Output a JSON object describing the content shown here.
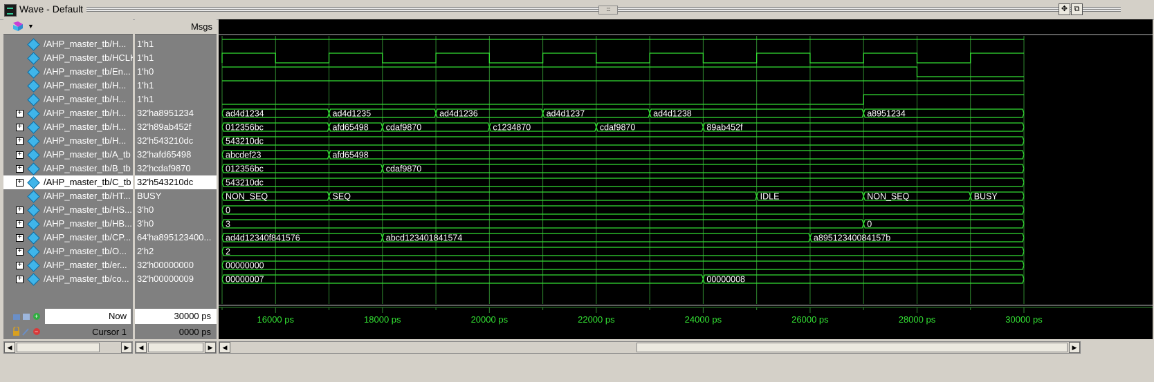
{
  "window": {
    "title": "Wave - Default"
  },
  "names_header": {
    "filter_icon": "wave-filter-icon"
  },
  "values_header": {
    "label": "Msgs"
  },
  "signals": [
    {
      "name": "/AHP_master_tb/H...",
      "value": "1'h1",
      "expandable": false
    },
    {
      "name": "/AHP_master_tb/HCLK",
      "value": "1'h1",
      "expandable": false
    },
    {
      "name": "/AHP_master_tb/En...",
      "value": "1'h0",
      "expandable": false
    },
    {
      "name": "/AHP_master_tb/H...",
      "value": "1'h1",
      "expandable": false
    },
    {
      "name": "/AHP_master_tb/H...",
      "value": "1'h1",
      "expandable": false
    },
    {
      "name": "/AHP_master_tb/H...",
      "value": "32'ha8951234",
      "expandable": true
    },
    {
      "name": "/AHP_master_tb/H...",
      "value": "32'h89ab452f",
      "expandable": true
    },
    {
      "name": "/AHP_master_tb/H...",
      "value": "32'h543210dc",
      "expandable": true
    },
    {
      "name": "/AHP_master_tb/A_tb",
      "value": "32'hafd65498",
      "expandable": true
    },
    {
      "name": "/AHP_master_tb/B_tb",
      "value": "32'hcdaf9870",
      "expandable": true
    },
    {
      "name": "/AHP_master_tb/C_tb",
      "value": "32'h543210dc",
      "expandable": true,
      "selected": true
    },
    {
      "name": "/AHP_master_tb/HT...",
      "value": "BUSY",
      "expandable": false
    },
    {
      "name": "/AHP_master_tb/HS...",
      "value": "3'h0",
      "expandable": true
    },
    {
      "name": "/AHP_master_tb/HB...",
      "value": "3'h0",
      "expandable": true
    },
    {
      "name": "/AHP_master_tb/CP...",
      "value": "64'ha895123400...",
      "expandable": true
    },
    {
      "name": "/AHP_master_tb/O...",
      "value": "2'h2",
      "expandable": true
    },
    {
      "name": "/AHP_master_tb/er...",
      "value": "32'h00000000",
      "expandable": true
    },
    {
      "name": "/AHP_master_tb/co...",
      "value": "32'h00000009",
      "expandable": true
    }
  ],
  "waveform": {
    "time_start_ps": 15000,
    "time_end_ps": 30000,
    "ticks": [
      "16000 ps",
      "18000 ps",
      "20000 ps",
      "22000 ps",
      "24000 ps",
      "26000 ps",
      "28000 ps",
      "30000 ps"
    ],
    "tick_values": [
      16000,
      18000,
      20000,
      22000,
      24000,
      26000,
      28000,
      30000
    ],
    "colors": {
      "wave": "#33e033",
      "grid": "#2f8a2f",
      "background": "#000000",
      "tick_label": "#33e033"
    },
    "bit_signals": [
      {
        "row": 0,
        "transitions": [
          [
            15000,
            1
          ]
        ]
      },
      {
        "row": 1,
        "transitions": [
          [
            15000,
            0
          ],
          [
            15000,
            1
          ],
          [
            16000,
            0
          ],
          [
            17000,
            1
          ],
          [
            18000,
            0
          ],
          [
            19000,
            1
          ],
          [
            20000,
            0
          ],
          [
            21000,
            1
          ],
          [
            22000,
            0
          ],
          [
            23000,
            1
          ],
          [
            24000,
            0
          ],
          [
            25000,
            1
          ],
          [
            26000,
            0
          ],
          [
            27000,
            1
          ],
          [
            28000,
            0
          ],
          [
            29000,
            1
          ]
        ]
      },
      {
        "row": 2,
        "transitions": [
          [
            15000,
            1
          ],
          [
            28000,
            0
          ]
        ]
      },
      {
        "row": 3,
        "transitions": [
          [
            15000,
            1
          ]
        ]
      },
      {
        "row": 4,
        "transitions": [
          [
            15000,
            0
          ],
          [
            27000,
            1
          ]
        ]
      }
    ],
    "bus_signals": [
      {
        "row": 5,
        "segments": [
          [
            15000,
            "ad4d1234"
          ],
          [
            17000,
            "ad4d1235"
          ],
          [
            19000,
            "ad4d1236"
          ],
          [
            21000,
            "ad4d1237"
          ],
          [
            23000,
            "ad4d1238"
          ],
          [
            27000,
            "a8951234"
          ]
        ]
      },
      {
        "row": 6,
        "segments": [
          [
            15000,
            "012356bc"
          ],
          [
            17000,
            "afd65498"
          ],
          [
            18000,
            "cdaf9870"
          ],
          [
            20000,
            "c1234870"
          ],
          [
            22000,
            "cdaf9870"
          ],
          [
            24000,
            "89ab452f"
          ]
        ]
      },
      {
        "row": 7,
        "segments": [
          [
            15000,
            "543210dc"
          ]
        ]
      },
      {
        "row": 8,
        "segments": [
          [
            15000,
            "abcdef23"
          ],
          [
            17000,
            "afd65498"
          ]
        ]
      },
      {
        "row": 9,
        "segments": [
          [
            15000,
            "012356bc"
          ],
          [
            18000,
            "cdaf9870"
          ]
        ]
      },
      {
        "row": 10,
        "segments": [
          [
            15000,
            "543210dc"
          ]
        ]
      },
      {
        "row": 11,
        "segments": [
          [
            15000,
            "NON_SEQ"
          ],
          [
            17000,
            "SEQ"
          ],
          [
            25000,
            "IDLE"
          ],
          [
            27000,
            "NON_SEQ"
          ],
          [
            29000,
            "BUSY"
          ]
        ]
      },
      {
        "row": 12,
        "segments": [
          [
            15000,
            "0"
          ]
        ]
      },
      {
        "row": 13,
        "segments": [
          [
            15000,
            "3"
          ],
          [
            27000,
            "0"
          ]
        ]
      },
      {
        "row": 14,
        "segments": [
          [
            15000,
            "ad4d12340f841576"
          ],
          [
            18000,
            "abcd123401841574"
          ],
          [
            26000,
            "a89512340084157b"
          ]
        ]
      },
      {
        "row": 15,
        "segments": [
          [
            15000,
            "2"
          ]
        ]
      },
      {
        "row": 16,
        "segments": [
          [
            15000,
            "00000000"
          ]
        ]
      },
      {
        "row": 17,
        "segments": [
          [
            15000,
            "00000007"
          ],
          [
            24000,
            "00000008"
          ]
        ]
      }
    ]
  },
  "footer": {
    "now_label": "Now",
    "now_value": "30000 ps",
    "cursor_label": "Cursor 1",
    "cursor_value": "0000 ps"
  }
}
